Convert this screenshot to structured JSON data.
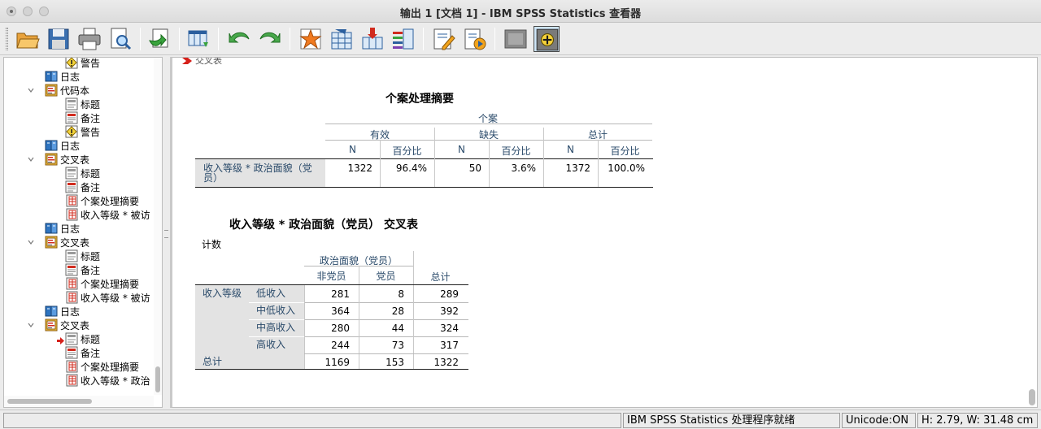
{
  "window": {
    "title": "输出 1 [文档 1] - IBM SPSS Statistics 查看器"
  },
  "toolbar": {
    "buttons": [
      {
        "icon": "open-folder-icon"
      },
      {
        "icon": "save-disk-icon"
      },
      {
        "icon": "print-icon"
      },
      {
        "icon": "print-preview-icon"
      },
      {
        "icon": "export-icon"
      },
      {
        "icon": "goto-data-icon"
      },
      {
        "icon": "undo-icon"
      },
      {
        "icon": "redo-icon"
      },
      {
        "icon": "goto-case-star-icon"
      },
      {
        "icon": "goto-variable-icon"
      },
      {
        "icon": "insert-variable-icon"
      },
      {
        "icon": "variable-list-icon"
      },
      {
        "icon": "designate-window-icon"
      },
      {
        "icon": "run-script-icon"
      },
      {
        "icon": "show-hide-icon"
      },
      {
        "icon": "expand-add-icon"
      }
    ]
  },
  "outline": {
    "items": [
      {
        "label": "警告",
        "icon": "warning-icon"
      },
      {
        "label": "日志",
        "icon": "log-book-icon"
      },
      {
        "label": "代码本",
        "icon": "procedure-icon"
      },
      {
        "label": "标题",
        "icon": "title-icon"
      },
      {
        "label": "备注",
        "icon": "notes-icon"
      },
      {
        "label": "警告",
        "icon": "warning-icon"
      },
      {
        "label": "日志",
        "icon": "log-book-icon"
      },
      {
        "label": "交叉表",
        "icon": "procedure-icon"
      },
      {
        "label": "标题",
        "icon": "title-icon"
      },
      {
        "label": "备注",
        "icon": "notes-icon"
      },
      {
        "label": "个案处理摘要",
        "icon": "table-icon"
      },
      {
        "label": "收入等级 * 被访",
        "icon": "table-icon"
      },
      {
        "label": "日志",
        "icon": "log-book-icon"
      },
      {
        "label": "交叉表",
        "icon": "procedure-icon"
      },
      {
        "label": "标题",
        "icon": "title-icon"
      },
      {
        "label": "备注",
        "icon": "notes-icon"
      },
      {
        "label": "个案处理摘要",
        "icon": "table-icon"
      },
      {
        "label": "收入等级 * 被访",
        "icon": "table-icon"
      },
      {
        "label": "日志",
        "icon": "log-book-icon"
      },
      {
        "label": "交叉表",
        "icon": "procedure-icon"
      },
      {
        "label": "标题",
        "icon": "title-icon"
      },
      {
        "label": "备注",
        "icon": "notes-icon"
      },
      {
        "label": "个案处理摘要",
        "icon": "table-icon"
      },
      {
        "label": "收入等级 * 政治",
        "icon": "table-icon"
      }
    ]
  },
  "content": {
    "cutoff_heading": "交叉表",
    "summary": {
      "title": "个案处理摘要",
      "group_header": "个案",
      "col_groups": [
        "有效",
        "缺失",
        "总计"
      ],
      "sub_headers": [
        "N",
        "百分比",
        "N",
        "百分比",
        "N",
        "百分比"
      ],
      "row_label": "收入等级 * 政治面貌（党员）",
      "values": [
        "1322",
        "96.4%",
        "50",
        "3.6%",
        "1372",
        "100.0%"
      ]
    },
    "crosstab": {
      "title": "收入等级 * 政治面貌（党员） 交叉表",
      "count_label": "计数",
      "col_var": "政治面貌（党员）",
      "col_headers": [
        "非党员",
        "党员",
        "总计"
      ],
      "row_var": "收入等级",
      "rows": [
        {
          "label": "低收入",
          "values": [
            "281",
            "8",
            "289"
          ]
        },
        {
          "label": "中低收入",
          "values": [
            "364",
            "28",
            "392"
          ]
        },
        {
          "label": "中高收入",
          "values": [
            "280",
            "44",
            "324"
          ]
        },
        {
          "label": "高收入",
          "values": [
            "244",
            "73",
            "317"
          ]
        }
      ],
      "total_label": "总计",
      "total_values": [
        "1169",
        "153",
        "1322"
      ]
    }
  },
  "status": {
    "processor": "IBM SPSS Statistics 处理程序就绪",
    "unicode": "Unicode:ON",
    "dims": "H: 2.79, W: 31.48 cm"
  }
}
